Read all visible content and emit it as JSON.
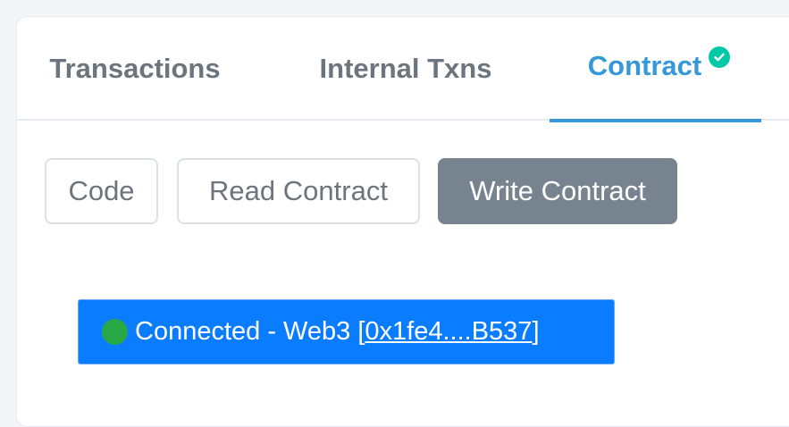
{
  "tabs": [
    {
      "label": "Transactions",
      "active": false
    },
    {
      "label": "Internal Txns",
      "active": false
    },
    {
      "label": "Contract",
      "active": true,
      "badge_icon": "check-circle-icon"
    }
  ],
  "subtabs": [
    {
      "label": "Code",
      "active": false
    },
    {
      "label": "Read Contract",
      "active": false
    },
    {
      "label": "Write Contract",
      "active": true
    }
  ],
  "connection": {
    "status_icon": "green-dot-icon",
    "text": "Connected - Web3",
    "open_bracket": "[",
    "address": "0x1fe4....B537",
    "close_bracket": "]"
  },
  "colors": {
    "accent": "#3498db",
    "verified_badge": "#00c9a7",
    "active_subtab": "#77838f",
    "connected_banner": "#0a7cff",
    "status_dot": "#28a745",
    "muted_text": "#6c757d"
  }
}
